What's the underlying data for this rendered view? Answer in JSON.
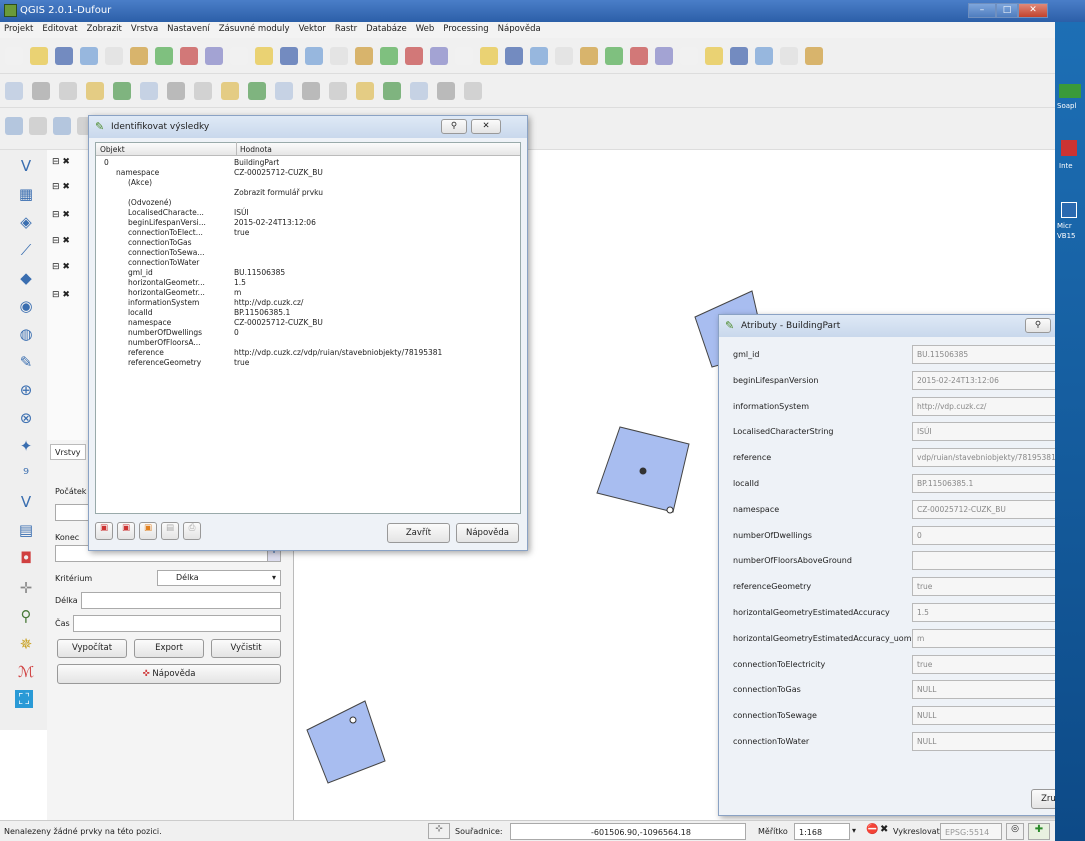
{
  "window": {
    "title": "QGIS 2.0.1-Dufour",
    "min": "–",
    "max": "□",
    "close": "✕"
  },
  "menu": [
    "Projekt",
    "Editovat",
    "Zobrazit",
    "Vrstva",
    "Nastavení",
    "Zásuvné moduly",
    "Vektor",
    "Rastr",
    "Databáze",
    "Web",
    "Processing",
    "Nápověda"
  ],
  "identify": {
    "title": "Identifikovat výsledky",
    "col_object": "Objekt",
    "col_value": "Hodnota",
    "rows": [
      {
        "k": "0",
        "v": "BuildingPart",
        "indent": 0
      },
      {
        "k": "namespace",
        "v": "CZ-00025712-CUZK_BU",
        "indent": 1
      },
      {
        "k": "(Akce)",
        "v": "",
        "indent": 2
      },
      {
        "k": "",
        "v": "Zobrazit formulář prvku",
        "indent": 3
      },
      {
        "k": "(Odvozené)",
        "v": "",
        "indent": 2
      },
      {
        "k": "LocalisedCharacte...",
        "v": "ISÚI",
        "indent": 2
      },
      {
        "k": "beginLifespanVersi...",
        "v": "2015-02-24T13:12:06",
        "indent": 2
      },
      {
        "k": "connectionToElect...",
        "v": "true",
        "indent": 2
      },
      {
        "k": "connectionToGas",
        "v": "",
        "indent": 2
      },
      {
        "k": "connectionToSewa...",
        "v": "",
        "indent": 2
      },
      {
        "k": "connectionToWater",
        "v": "",
        "indent": 2
      },
      {
        "k": "gml_id",
        "v": "BU.11506385",
        "indent": 2
      },
      {
        "k": "horizontalGeometr...",
        "v": "1.5",
        "indent": 2
      },
      {
        "k": "horizontalGeometr...",
        "v": "m",
        "indent": 2
      },
      {
        "k": "informationSystem",
        "v": "http://vdp.cuzk.cz/",
        "indent": 2
      },
      {
        "k": "localId",
        "v": "BP.11506385.1",
        "indent": 2
      },
      {
        "k": "namespace",
        "v": "CZ-00025712-CUZK_BU",
        "indent": 2
      },
      {
        "k": "numberOfDwellings",
        "v": "0",
        "indent": 2
      },
      {
        "k": "numberOfFloorsA...",
        "v": "",
        "indent": 2
      },
      {
        "k": "reference",
        "v": "http://vdp.cuzk.cz/vdp/ruian/stavebniobjekty/78195381",
        "indent": 2
      },
      {
        "k": "referenceGeometry",
        "v": "true",
        "indent": 2
      }
    ],
    "close_btn": "Zavřít",
    "help_btn": "Nápověda"
  },
  "attr": {
    "title": "Atributy - BuildingPart",
    "fields": [
      {
        "label": "gml_id",
        "value": "BU.11506385"
      },
      {
        "label": "beginLifespanVersion",
        "value": "2015-02-24T13:12:06"
      },
      {
        "label": "informationSystem",
        "value": "http://vdp.cuzk.cz/"
      },
      {
        "label": "LocalisedCharacterString",
        "value": "ISÚI"
      },
      {
        "label": "reference",
        "value": "vdp/ruian/stavebniobjekty/78195381"
      },
      {
        "label": "localId",
        "value": "BP.11506385.1"
      },
      {
        "label": "namespace",
        "value": "CZ-00025712-CUZK_BU"
      },
      {
        "label": "numberOfDwellings",
        "value": "0"
      },
      {
        "label": "numberOfFloorsAboveGround",
        "value": ""
      },
      {
        "label": "referenceGeometry",
        "value": "true"
      },
      {
        "label": "horizontalGeometryEstimatedAccuracy",
        "value": "1.5"
      },
      {
        "label": "horizontalGeometryEstimatedAccuracy_uom",
        "value": "m"
      },
      {
        "label": "connectionToElectricity",
        "value": "true"
      },
      {
        "label": "connectionToGas",
        "value": "NULL"
      },
      {
        "label": "connectionToSewage",
        "value": "NULL"
      },
      {
        "label": "connectionToWater",
        "value": "NULL"
      }
    ],
    "close_btn": "Zrušit"
  },
  "route": {
    "tab": "Vrstvy",
    "start_label": "Počátek",
    "end_label": "Konec",
    "criterion_label": "Kritérium",
    "criterion_value": "Délka",
    "length_label": "Délka",
    "time_label": "Čas",
    "calc_btn": "Vypočítat",
    "export_btn": "Export",
    "clear_btn": "Vyčistit",
    "help_btn": "Nápověda"
  },
  "status": {
    "message": "Nenalezeny žádné prvky na této pozici.",
    "coords_label": "Souřadnice:",
    "coords_value": "-601506.90,-1096564.18",
    "scale_label": "Měřítko",
    "scale_value": "1:168",
    "render_label": "Vykreslovat",
    "epsg": "EPSG:5514"
  },
  "desktop": [
    "Soapl",
    "Inte",
    "Micr",
    "VB15"
  ],
  "colors": {
    "building_fill": "#a8bdf0",
    "building_stroke": "#444",
    "title_bar": "#2c5fa8"
  }
}
